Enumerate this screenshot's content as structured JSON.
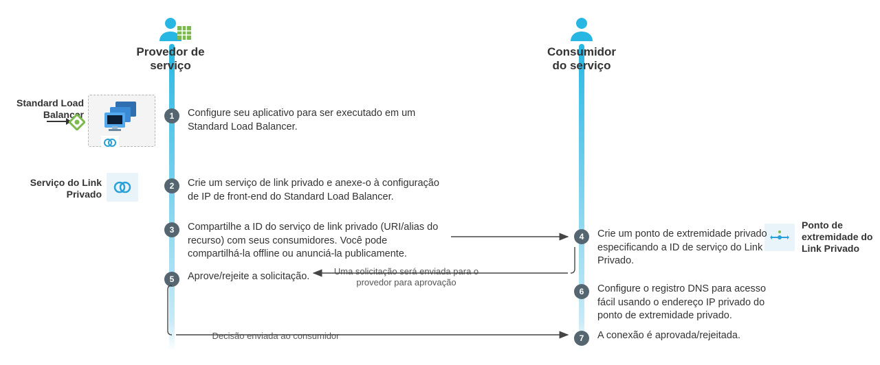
{
  "personas": {
    "provider": "Provedor de\nserviço",
    "consumer": "Consumidor\ndo serviço"
  },
  "side_labels": {
    "slb": "Standard Load Balancer",
    "pls": "Serviço do Link Privado",
    "plep": "Ponto de extremidade do Link Privado"
  },
  "steps": {
    "s1": {
      "n": "1",
      "text": "Configure seu aplicativo para ser executado em um Standard Load Balancer."
    },
    "s2": {
      "n": "2",
      "text": "Crie um serviço de link privado e anexe-o à configuração de IP de front-end do Standard Load Balancer."
    },
    "s3": {
      "n": "3",
      "text": "Compartilhe a ID do serviço de link privado (URI/alias do recurso) com seus consumidores. Você pode compartilhá-la offline ou anunciá-la publicamente."
    },
    "s4": {
      "n": "4",
      "text": "Crie um ponto de extremidade privado especificando a ID de serviço do Link Privado."
    },
    "s5": {
      "n": "5",
      "text": "Aprove/rejeite a solicitação."
    },
    "s6": {
      "n": "6",
      "text": "Configure o registro DNS para acesso fácil usando o endereço IP privado do ponto de extremidade privado."
    },
    "s7": {
      "n": "7",
      "text": "A conexão é aprovada/rejeitada."
    }
  },
  "arrow_captions": {
    "provider_approval": "Uma solicitação será enviada para o provedor para aprovação",
    "decision_sent": "Decisão enviada ao consumidor"
  },
  "colors": {
    "azure_blue": "#28b7e3",
    "node_bg": "#556670",
    "tile_bg": "#e8f4fa",
    "green": "#7dba4e"
  }
}
